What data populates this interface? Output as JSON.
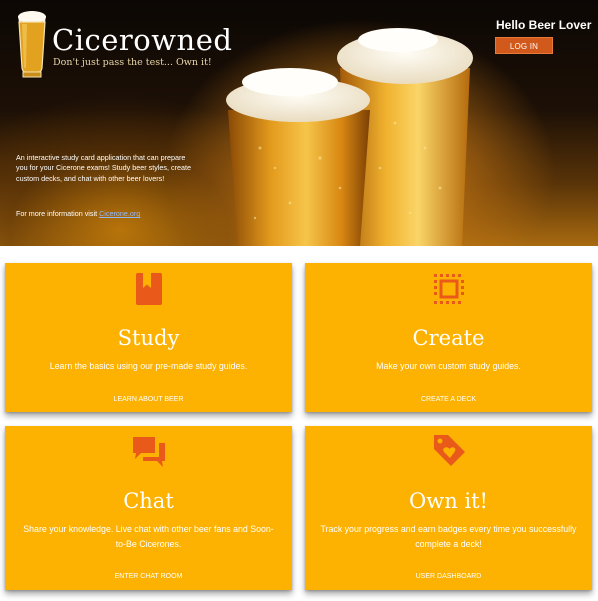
{
  "header": {
    "brand_name": "Cicerowned",
    "tagline": "Don't just pass the test... Own it!",
    "greeting": "Hello Beer Lover",
    "login_label": "LOG IN",
    "intro_text": "An interactive study card application that can prepare you for your Cicerone exams! Study beer styles, create custom decks, and chat with other beer lovers!",
    "more_info_prefix": "For more information visit ",
    "more_info_link": "Cicerone.org"
  },
  "cards": [
    {
      "title": "Study",
      "icon": "book-icon",
      "description": "Learn the basics using our pre-made study guides.",
      "link_label": "LEARN ABOUT BEER"
    },
    {
      "title": "Create",
      "icon": "frame-icon",
      "description": "Make your own custom study guides.",
      "link_label": "CREATE A DECK"
    },
    {
      "title": "Chat",
      "icon": "chat-icon",
      "description": "Share your knowledge. Live chat with other beer fans and Soon-to-Be Cicerones.",
      "link_label": "ENTER CHAT ROOM"
    },
    {
      "title": "Own it!",
      "icon": "tag-heart-icon",
      "description": "Track your progress and earn badges every time you successfully complete a deck!",
      "link_label": "USER DASHBOARD"
    }
  ],
  "colors": {
    "card_bg": "#fdb201",
    "icon_color": "#e8591a",
    "login_button": "#d2591c"
  }
}
